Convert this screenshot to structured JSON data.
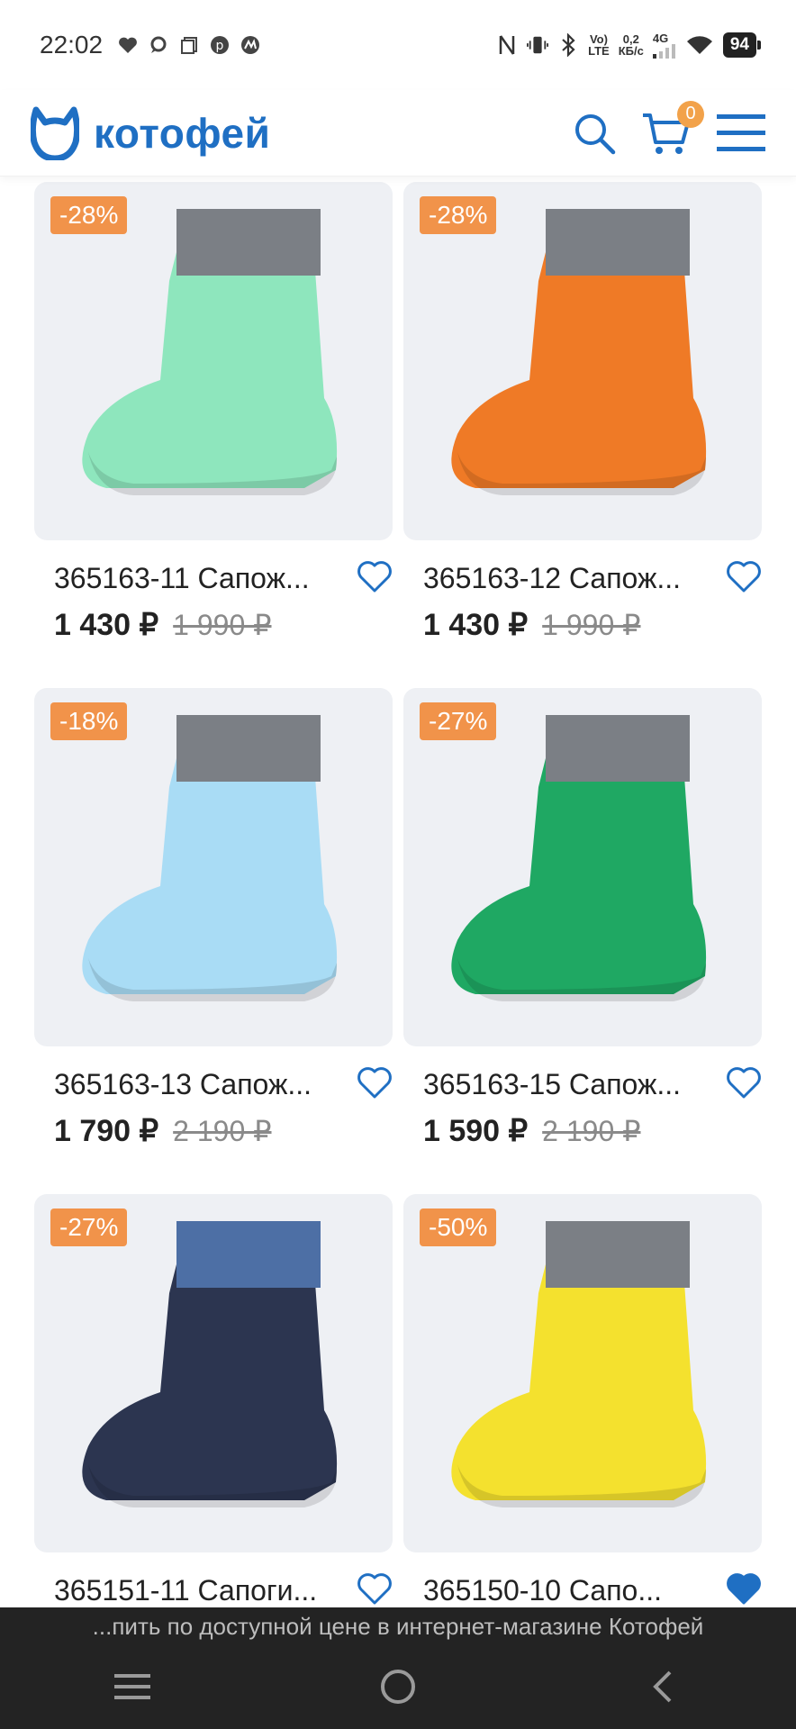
{
  "status_bar": {
    "time": "22:02",
    "network_label_top": "Vo)",
    "network_label_bottom": "LTE",
    "speed_top": "0,2",
    "speed_bottom": "КБ/с",
    "signal_type": "4G",
    "battery": "94"
  },
  "header": {
    "logo_text": "котофей",
    "cart_count": "0",
    "brand_color": "#1f6fc3",
    "accent_color": "#f1934a"
  },
  "products": [
    {
      "title": "365163-11 Сапож...",
      "price": "1 430 ₽",
      "old_price": "1 990 ₽",
      "discount": "-28%",
      "favorited": false,
      "boot_color": "#8ee6bd",
      "cuff_color": "#7b7f85"
    },
    {
      "title": "365163-12 Сапож...",
      "price": "1 430 ₽",
      "old_price": "1 990 ₽",
      "discount": "-28%",
      "favorited": false,
      "boot_color": "#ef7a26",
      "cuff_color": "#7b7f85"
    },
    {
      "title": "365163-13 Сапож...",
      "price": "1 790 ₽",
      "old_price": "2 190 ₽",
      "discount": "-18%",
      "favorited": false,
      "boot_color": "#a9dcf5",
      "cuff_color": "#7b7f85"
    },
    {
      "title": "365163-15 Сапож...",
      "price": "1 590 ₽",
      "old_price": "2 190 ₽",
      "discount": "-27%",
      "favorited": false,
      "boot_color": "#1fa863",
      "cuff_color": "#7b7f85"
    },
    {
      "title": "365151-11 Сапоги...",
      "price": "",
      "old_price": "",
      "discount": "-27%",
      "favorited": false,
      "boot_color": "#2c3550",
      "cuff_color": "#4d6fa5"
    },
    {
      "title": "365150-10 Сапо...",
      "price": "",
      "old_price": "",
      "discount": "-50%",
      "favorited": true,
      "boot_color": "#f4e12e",
      "cuff_color": "#7b7f85"
    }
  ],
  "bottom_bar": {
    "caption": "...пить по доступной цене в интернет-магазине Котофей"
  }
}
